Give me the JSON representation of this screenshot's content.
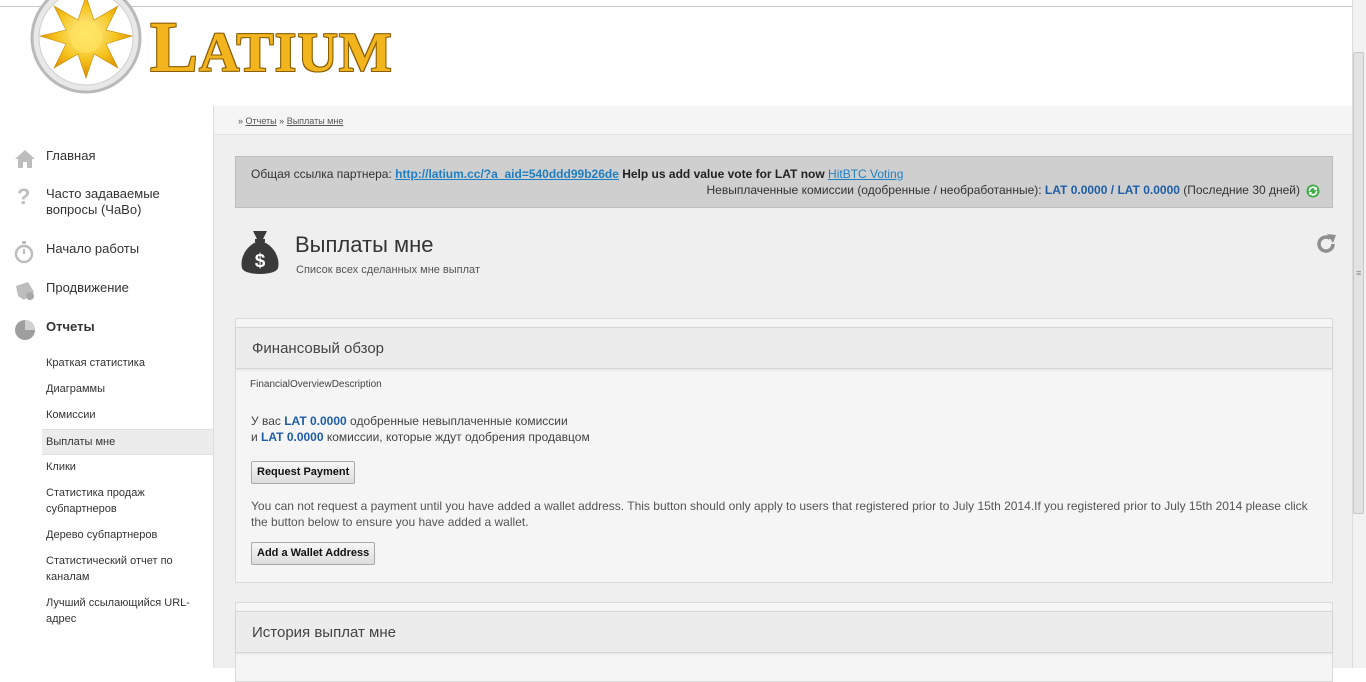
{
  "brand": {
    "logo_text_cap": "L",
    "logo_text_rest": "ATIUM"
  },
  "sidebar": {
    "items": [
      {
        "label": "Главная",
        "icon": "home-icon"
      },
      {
        "label": "Часто задаваемые вопросы (ЧаВо)",
        "icon": "question-icon"
      },
      {
        "label": "Начало работы",
        "icon": "stopwatch-icon"
      },
      {
        "label": "Продвижение",
        "icon": "promotion-icon"
      },
      {
        "label": "Отчеты",
        "icon": "pie-chart-icon"
      }
    ],
    "sub_items": [
      "Краткая статистика",
      "Диаграммы",
      "Комиссии",
      "Выплаты мне",
      "Клики",
      "Статистика продаж субпартнеров",
      "Дерево субпартнеров",
      "Статистический отчет по каналам",
      "Лучший ссылающийся URL-адрес"
    ]
  },
  "breadcrumb": {
    "sep": "»",
    "crumb1": "Отчеты",
    "crumb2": "Выплаты мне"
  },
  "affiliate": {
    "prefix": "Общая ссылка партнера:",
    "link": "http://latium.cc/?a_aid=540ddd99b26de",
    "help_text": "Help us add value vote for LAT now",
    "voting_link": "HitBTC Voting",
    "unpaid_label": "Невыплаченные комиссии (одобренные / необработанные):",
    "approved": "LAT 0.0000",
    "slash": "/",
    "pending": "LAT 0.0000",
    "period": "(Последние 30 дней)"
  },
  "page": {
    "title": "Выплаты мне",
    "subtitle": "Список всех сделанных мне выплат"
  },
  "financial": {
    "title": "Финансовый обзор",
    "description": "FinancialOverviewDescription",
    "line1_prefix": "У вас",
    "line1_amount": "LAT 0.0000",
    "line1_suffix": "одобренные невыплаченные комиссии",
    "line2_prefix": "и",
    "line2_amount": "LAT 0.0000",
    "line2_suffix": "комиссии, которые ждут одобрения продавцом",
    "request_button": "Request Payment",
    "notice": "You can not request a payment until you have added a wallet address. This button should only apply to users that registered prior to July 15th 2014.If you registered prior to July 15th 2014 please click the button below to ensure you have added a wallet.",
    "wallet_button": "Add a Wallet Address"
  },
  "history": {
    "title": "История выплат мне"
  },
  "colors": {
    "accent_blue": "#1e5ea8",
    "link_blue": "#1f7fc2",
    "logo_gold": "#f2b51e"
  }
}
